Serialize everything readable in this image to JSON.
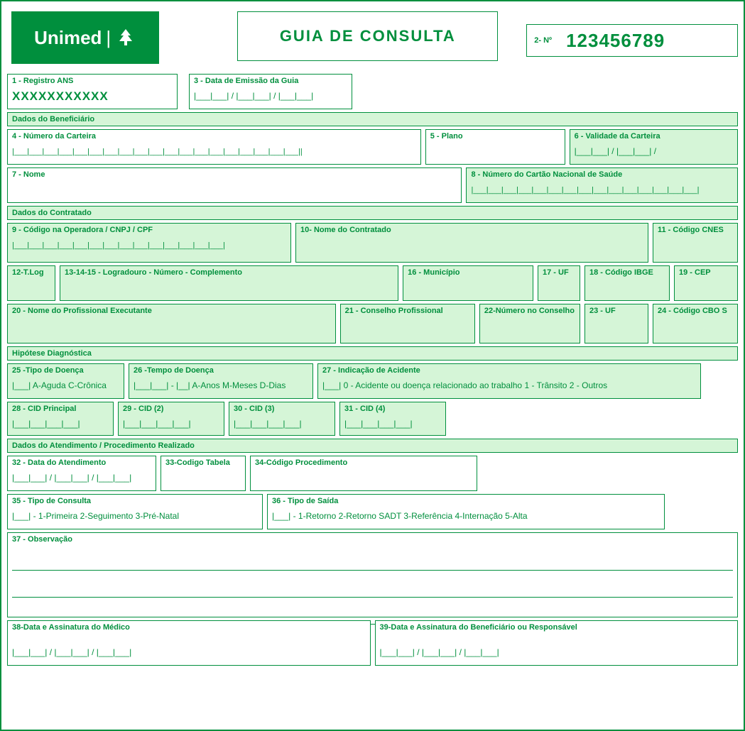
{
  "brand": "Unimed",
  "header": {
    "title": "GUIA  DE  CONSULTA",
    "guide_number_label": "2- Nº",
    "guide_number_value": "123456789"
  },
  "fields": {
    "f1_label": "1 - Registro ANS",
    "f1_value": "XXXXXXXXXXX",
    "f3_label": "3 - Data de Emissão da Guia",
    "f3_fill": "|___|___| / |___|___| / |___|___|",
    "sec_benef": "Dados do Beneficiário",
    "f4_label": "4 - Número da Carteira",
    "f4_fill": "|___|___|___|___|___|___|___|___|___|___|___|___|___|___|___|___|___|___|___||",
    "f5_label": "5 - Plano",
    "f6_label": "6 - Validade da Carteira",
    "f6_fill": "|___|___| / |___|___| /",
    "f7_label": "7 - Nome",
    "f8_label": "8 - Número do Cartão Nacional de Saúde",
    "f8_fill": "|___|___|___|___|___|___|___|___|___|___|___|___|___|___|___|",
    "sec_contratado": "Dados do Contratado",
    "f9_label": "9 - Código na Operadora / CNPJ / CPF",
    "f9_fill": "|___|___|___|___|___|___|___|___|___|___|___|___|___|___|",
    "f10_label": "10- Nome do Contratado",
    "f11_label": "11 - Código CNES",
    "f12_label": "12-T.Log",
    "f13_label": "13-14-15 - Logradouro - Número - Complemento",
    "f16_label": "16 - Município",
    "f17_label": "17 - UF",
    "f18_label": "18 - Código IBGE",
    "f19_label": "19 - CEP",
    "f20_label": "20 - Nome do Profissional Executante",
    "f21_label": "21 - Conselho Profissional",
    "f22_label": "22-Número no Conselho",
    "f23_label": "23 - UF",
    "f24_label": "24 - Código CBO S",
    "sec_hipotese": "Hipótese Diagnóstica",
    "f25_label": "25 -Tipo de Doença",
    "f25_sub": "|___|  A-Aguda  C-Crônica",
    "f26_label": "26 -Tempo de Doença",
    "f26_sub": "|___|___| - |__|  A-Anos  M-Meses D-Dias",
    "f27_label": "27 - Indicação de Acidente",
    "f27_sub": "|___|   0 - Acidente ou doença relacionado ao trabalho    1 - Trânsito   2 - Outros",
    "f28_label": "28 - CID Principal",
    "f28_fill": "|___|___|___|___|",
    "f29_label": "29 - CID (2)",
    "f29_fill": "|___|___|___|___|",
    "f30_label": "30 - CID (3)",
    "f30_fill": "|___|___|___|___|",
    "f31_label": "31 - CID (4)",
    "f31_fill": "|___|___|___|___|",
    "sec_atend": "Dados do Atendimento / Procedimento Realizado",
    "f32_label": "32 - Data do Atendimento",
    "f32_fill": "|___|___| / |___|___| / |___|___|",
    "f33_label": "33-Codigo Tabela",
    "f34_label": "34-Código Procedimento",
    "f35_label": "35 - Tipo de Consulta",
    "f35_sub": "|___|  -  1-Primeira    2-Seguimento    3-Pré-Natal",
    "f36_label": "36 - Tipo de Saída",
    "f36_sub": "|___|  -  1-Retorno    2-Retorno SADT    3-Referência    4-Internação    5-Alta",
    "f37_label": "37 - Observação",
    "f38_label": "38-Data e Assinatura do Médico",
    "f38_fill": "|___|___| / |___|___| / |___|___|",
    "f39_label": "39-Data e Assinatura do Beneficiário ou Responsável",
    "f39_fill": "|___|___| / |___|___| / |___|___|"
  }
}
